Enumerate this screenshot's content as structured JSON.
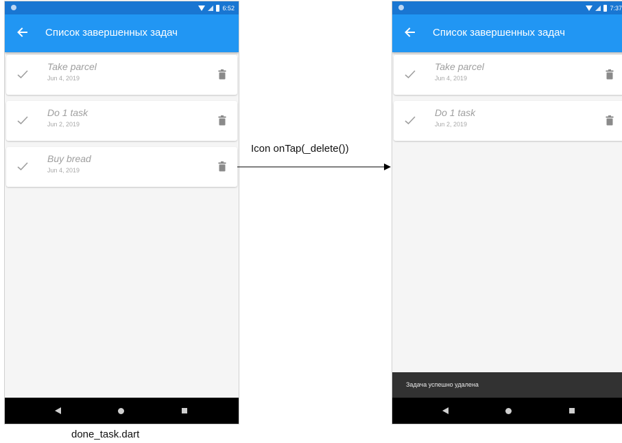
{
  "colors": {
    "status_bar": "#1976d2",
    "app_bar": "#2196f3",
    "background": "#f5f5f5",
    "snackbar": "#323232",
    "nav_bar": "#000000"
  },
  "left_phone": {
    "status": {
      "time": "6:52"
    },
    "app_bar": {
      "title": "Список завершенных задач",
      "back_icon": "arrow-back-icon"
    },
    "tasks": [
      {
        "title": "Take parcel",
        "date": "Jun 4, 2019"
      },
      {
        "title": "Do 1 task",
        "date": "Jun 2, 2019"
      },
      {
        "title": "Buy bread",
        "date": "Jun 4, 2019"
      }
    ]
  },
  "right_phone": {
    "status": {
      "time": "7:37"
    },
    "app_bar": {
      "title": "Список завершенных задач",
      "back_icon": "arrow-back-icon"
    },
    "tasks": [
      {
        "title": "Take parcel",
        "date": "Jun 4, 2019"
      },
      {
        "title": "Do 1 task",
        "date": "Jun 2, 2019"
      }
    ],
    "snackbar": {
      "text": "Задача успешно удалена"
    }
  },
  "transition": {
    "label": "Icon onTap(_delete())"
  },
  "caption": "done_task.dart"
}
